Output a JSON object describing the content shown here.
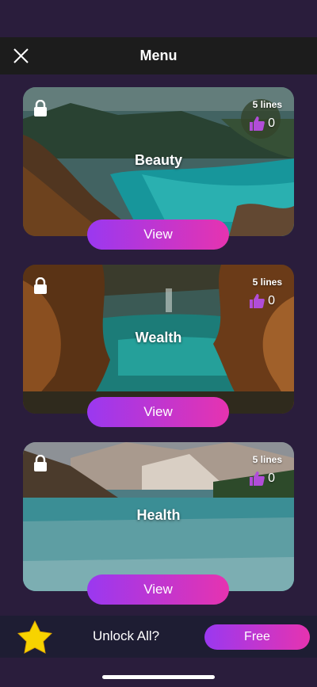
{
  "header": {
    "title": "Menu",
    "close_icon": "close-icon"
  },
  "cards": [
    {
      "name": "Beauty",
      "lines": "5 lines",
      "likes": "0",
      "view_label": "View",
      "scene": "coastal cliff with turquoise water"
    },
    {
      "name": "Wealth",
      "lines": "5 lines",
      "likes": "0",
      "view_label": "View",
      "scene": "autumn trees around teal lake"
    },
    {
      "name": "Health",
      "lines": "5 lines",
      "likes": "0",
      "view_label": "View",
      "scene": "mountain lake with forest"
    }
  ],
  "bottom_bar": {
    "unlock_text": "Unlock All?",
    "free_label": "Free"
  },
  "colors": {
    "background": "#2a1d3c",
    "header": "#1c1c1c",
    "accent_start": "#9a38f0",
    "accent_end": "#e633b0",
    "like": "#b14dd8",
    "star": "#f7d300"
  }
}
